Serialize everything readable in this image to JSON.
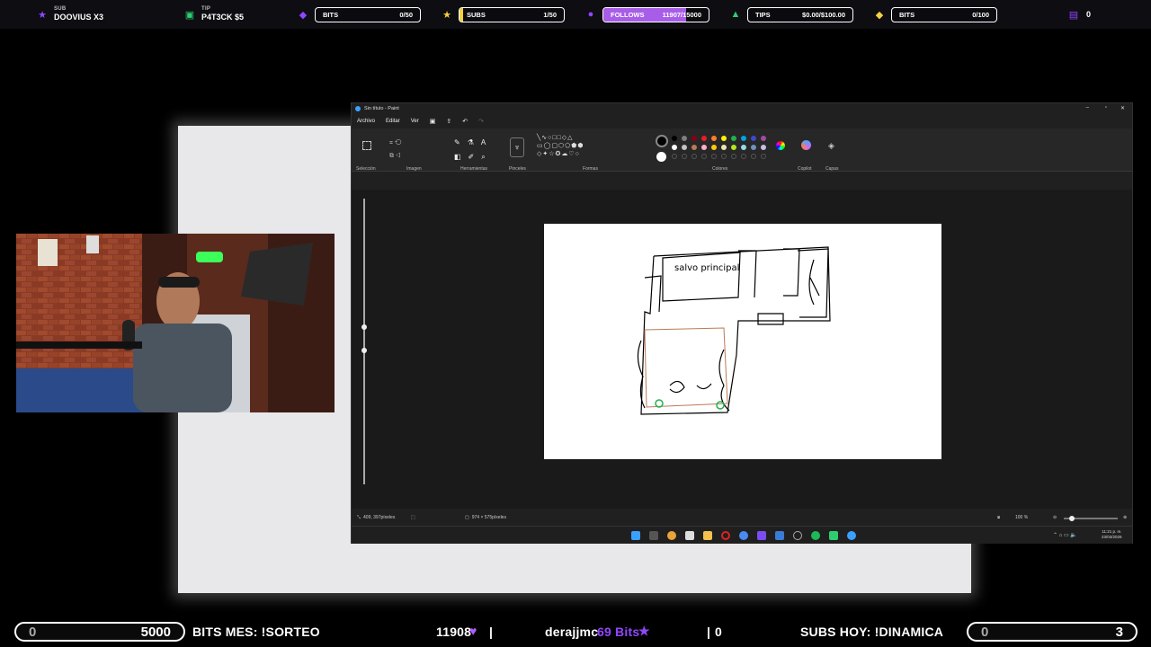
{
  "topbar": {
    "sub_label": "SUB",
    "sub_value": "DOOVIUS X3",
    "tip_label": "TIP",
    "tip_value": "P4T3CK $5",
    "bits1_label": "BITS",
    "bits1_value": "0/50",
    "subs_label": "SUBS",
    "subs_value": "1/50",
    "follows_label": "FOLLOWS",
    "follows_value": "11907/15000",
    "follows_progress": 0.79,
    "tips_label": "TIPS",
    "tips_value": "$0.00/$100.00",
    "bits2_label": "BITS",
    "bits2_value": "0/100",
    "twitch_count": "0",
    "colors": {
      "purple": "#9146ff",
      "gold": "#f5d142",
      "green": "#2ecc71"
    }
  },
  "paint": {
    "title": "Sin título - Paint",
    "menu": [
      "Archivo",
      "Editar",
      "Ver"
    ],
    "groups": [
      "Selección",
      "Imagen",
      "Herramientas",
      "Pinceles",
      "Formas",
      "Colores",
      "Copilot",
      "Capas"
    ],
    "status_position": "409, 397píxeles",
    "status_size": "974 × 575píxeles",
    "zoom": "100 %",
    "clock_time": "11:21 p. m.",
    "clock_date": "23/03/2026",
    "drawing_text": "salvo principal",
    "palette": [
      "#000000",
      "#7f7f7f",
      "#880015",
      "#ed1c24",
      "#ff7f27",
      "#fff200",
      "#22b14c",
      "#00a2e8",
      "#3f48cc",
      "#a349a4",
      "#ffffff",
      "#c3c3c3",
      "#b97a57",
      "#ffaec9",
      "#ffc90e",
      "#efe4b0",
      "#b5e61d",
      "#99d9ea",
      "#7092be",
      "#c8bfe7"
    ]
  },
  "bottombar": {
    "left_min": "0",
    "left_max": "5000",
    "left_label": "BITS MES: !SORTEO",
    "left_count": "11908",
    "user": "derajjmc",
    "user_bits": "69 Bits",
    "sep_count": "0",
    "right_label": "SUBS HOY: !DINAMICA",
    "right_min": "0",
    "right_max": "3"
  }
}
